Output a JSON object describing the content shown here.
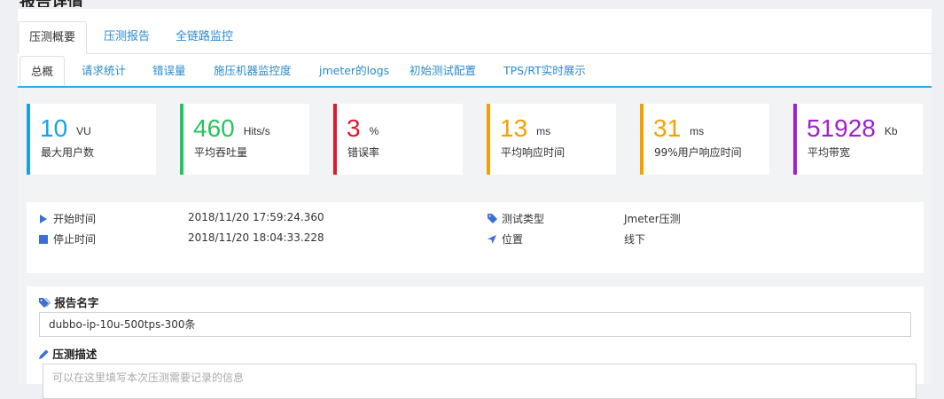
{
  "header": {
    "title_fragment": "报告详情",
    "right_fragment": ""
  },
  "tabs_primary": [
    {
      "label": "压测概要",
      "active": true
    },
    {
      "label": "压测报告",
      "active": false
    },
    {
      "label": "全链路监控",
      "active": false
    }
  ],
  "tabs_secondary": [
    {
      "label": "总概",
      "active": true
    },
    {
      "label": "请求统计",
      "active": false
    },
    {
      "label": "错误量",
      "active": false
    },
    {
      "label": "施压机器监控度",
      "active": false
    },
    {
      "label": "jmeter的logs",
      "active": false
    },
    {
      "label": "初始测试配置",
      "active": false
    },
    {
      "label": "TPS/RT实时展示",
      "active": false
    }
  ],
  "stats": [
    {
      "value": "10",
      "unit": "VU",
      "label": "最大用户数",
      "color": "#1aa0e8"
    },
    {
      "value": "460",
      "unit": "Hits/s",
      "label": "平均吞吐量",
      "color": "#22c55e"
    },
    {
      "value": "3",
      "unit": "%",
      "label": "错误率",
      "color": "#e0182d"
    },
    {
      "value": "13",
      "unit": "ms",
      "label": "平均响应时间",
      "color": "#f5a000"
    },
    {
      "value": "31",
      "unit": "ms",
      "label": "99%用户响应时间",
      "color": "#f5a000"
    },
    {
      "value": "51928",
      "unit": "Kb",
      "label": "平均带宽",
      "color": "#a020c8"
    }
  ],
  "info": {
    "start_label": "开始时间",
    "start_value": "2018/11/20 17:59:24.360",
    "stop_label": "停止时间",
    "stop_value": "2018/11/20 18:04:33.228",
    "type_label": "测试类型",
    "type_value": "Jmeter压测",
    "location_label": "位置",
    "location_value": "线下",
    "icon_color": "#3b6fd6"
  },
  "report": {
    "name_label": "报告名字",
    "name_value": "dubbo-ip-10u-500tps-300条",
    "desc_label": "压测描述",
    "desc_placeholder": "可以在这里填写本次压测需要记录的信息"
  }
}
